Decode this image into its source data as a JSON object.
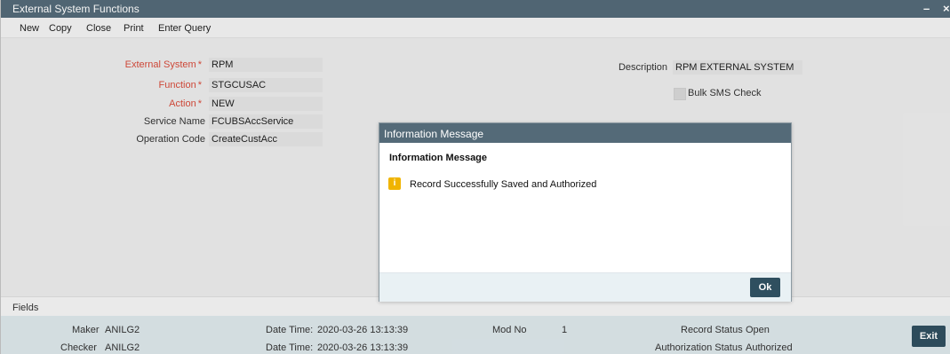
{
  "window": {
    "title": "External System Functions",
    "minimize": "–",
    "close": "×"
  },
  "toolbar": [
    "New",
    "Copy",
    "Close",
    "Print",
    "Enter Query"
  ],
  "form": {
    "external_system": {
      "label": "External System",
      "value": "RPM"
    },
    "function": {
      "label": "Function",
      "value": "STGCUSAC"
    },
    "action": {
      "label": "Action",
      "value": "NEW"
    },
    "service_name": {
      "label": "Service Name",
      "value": "FCUBSAccService"
    },
    "operation_code": {
      "label": "Operation Code",
      "value": "CreateCustAcc"
    },
    "description": {
      "label": "Description",
      "value": "RPM  EXTERNAL SYSTEM"
    },
    "bulk_sms": {
      "label": "Bulk SMS Check",
      "checked": false
    },
    "required_mark": "*"
  },
  "fields_label": "Fields",
  "footer": {
    "maker_label": "Maker",
    "maker": "ANILG2",
    "checker_label": "Checker",
    "checker": "ANILG2",
    "datetime_label": "Date Time:",
    "maker_datetime": "2020-03-26 13:13:39",
    "checker_datetime": "2020-03-26 13:13:39",
    "mod_no_label": "Mod No",
    "mod_no": "1",
    "record_status_label": "Record Status",
    "record_status": "Open",
    "auth_status_label": "Authorization Status",
    "auth_status": "Authorized",
    "exit_label": "Exit"
  },
  "dialog": {
    "title": "Information Message",
    "heading": "Information Message",
    "icon": "info-icon",
    "icon_glyph": "i",
    "message": "Record Successfully Saved and Authorized",
    "ok_label": "Ok"
  }
}
